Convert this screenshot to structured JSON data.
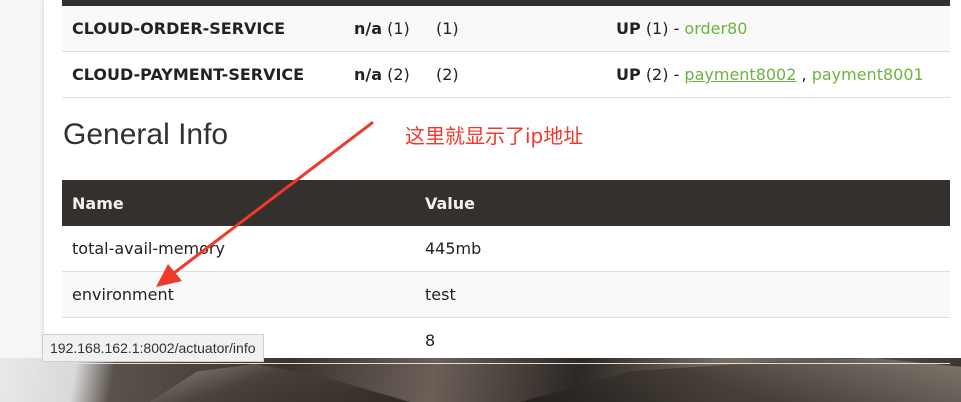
{
  "services": [
    {
      "name": "CLOUD-ORDER-SERVICE",
      "amis_status": "n/a",
      "amis_count": "(1)",
      "availability_zones": "(1)",
      "status": "UP",
      "status_count": "(1) - ",
      "instances": [
        {
          "label": "order80",
          "underlined": false
        }
      ]
    },
    {
      "name": "CLOUD-PAYMENT-SERVICE",
      "amis_status": "n/a",
      "amis_count": "(2)",
      "availability_zones": "(2)",
      "status": "UP",
      "status_count": "(2) - ",
      "instances": [
        {
          "label": "payment8002",
          "underlined": true
        },
        {
          "label": "payment8001",
          "underlined": false
        }
      ],
      "instance_separator": " , "
    }
  ],
  "general_info": {
    "title": "General Info",
    "headers": [
      "Name",
      "Value"
    ],
    "rows": [
      {
        "name": "total-avail-memory",
        "value": "445mb"
      },
      {
        "name": "environment",
        "value": "test"
      },
      {
        "name": "",
        "value": "8"
      }
    ]
  },
  "annotation": {
    "text": "这里就显示了ip地址",
    "color": "#f0382b"
  },
  "status_bar": {
    "url": "192.168.162.1:8002/actuator/info"
  },
  "colors": {
    "header_bg": "#34302d",
    "link": "#6db33f",
    "annotation": "#f0382b"
  }
}
